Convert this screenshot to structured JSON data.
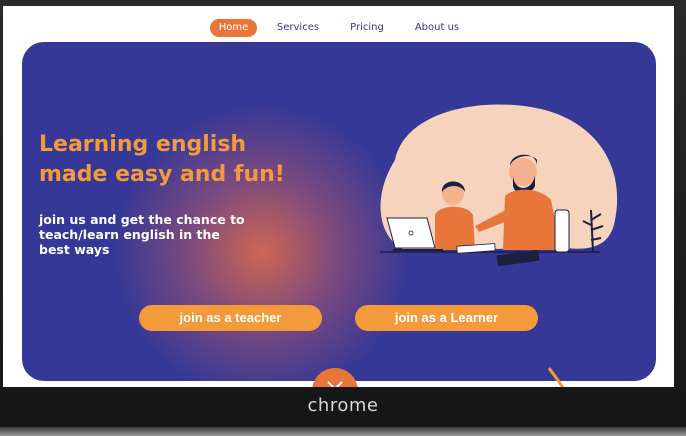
{
  "nav": {
    "items": [
      {
        "label": "Home",
        "active": true
      },
      {
        "label": "Services",
        "active": false
      },
      {
        "label": "Pricing",
        "active": false
      },
      {
        "label": "About us",
        "active": false
      }
    ]
  },
  "hero": {
    "headline_line1": "Learning english",
    "headline_line2": "made easy and fun!",
    "subtext_line1": "join us and get the chance to",
    "subtext_line2": "teach/learn english in the",
    "subtext_line3": "best ways",
    "teacher_button": "join as a teacher",
    "learner_button": "join as a Learner"
  },
  "device": {
    "brand": "chrome"
  },
  "colors": {
    "accent": "#f39a3a",
    "nav_active": "#e8763a",
    "hero_bg": "#353896",
    "nav_text": "#2e3a8c"
  },
  "icons": {
    "scroll": "chevron-down-icon"
  }
}
